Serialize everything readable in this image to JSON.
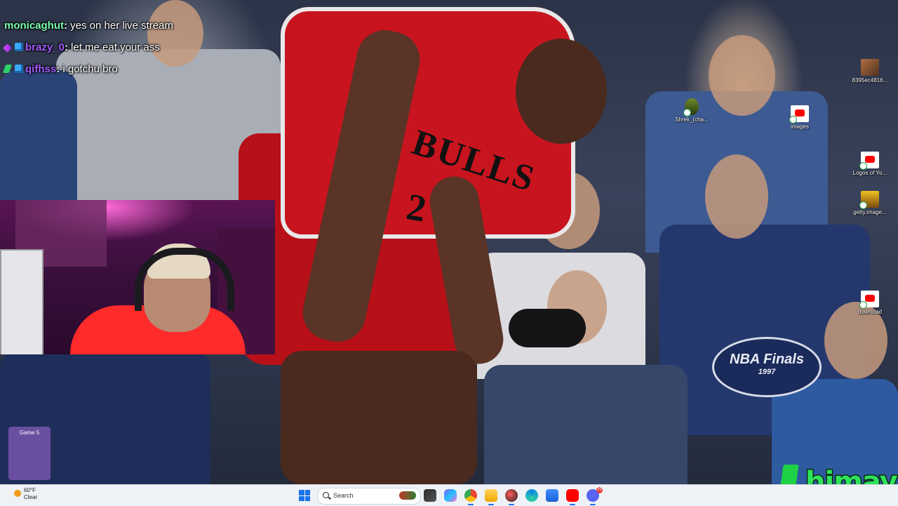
{
  "chat": {
    "messages": [
      {
        "user": "monicaghut",
        "user_color": "#7CFFB2",
        "text": "yes on her live stream",
        "badges": []
      },
      {
        "user": "brazy_0",
        "user_color": "#A45CFF",
        "text": "let me eat your ass",
        "badges": [
          "sword",
          "cube"
        ]
      },
      {
        "user": "qifhss",
        "user_color": "#A45CFF",
        "text": "i gotchu bro",
        "badges": [
          "green",
          "cube"
        ]
      }
    ],
    "separator": ":"
  },
  "photo": {
    "jersey_text": "BULLS",
    "jersey_number": "2",
    "patch_text": "NBA Finals",
    "patch_year": "1997",
    "badge_text": "Game 5"
  },
  "desktop_icons": [
    {
      "label": "8395ec4816...",
      "icon": "image-icon"
    },
    {
      "label": "Shrek_(cha...",
      "icon": "shrek-icon"
    },
    {
      "label": "images",
      "icon": "youtube-icon"
    },
    {
      "label": "Logos of Yo...",
      "icon": "youtube-icon"
    },
    {
      "label": "getty.image...",
      "icon": "image-icon"
    },
    {
      "label": "download",
      "icon": "youtube-icon"
    }
  ],
  "logo": {
    "text": "himay",
    "color": "#2FE25A"
  },
  "taskbar": {
    "weather": {
      "temp": "60°F",
      "condition": "Clear"
    },
    "search_placeholder": "Search",
    "apps": [
      {
        "name": "task-view"
      },
      {
        "name": "copilot"
      },
      {
        "name": "chrome"
      },
      {
        "name": "file-explorer"
      },
      {
        "name": "app-red"
      },
      {
        "name": "edge"
      },
      {
        "name": "store"
      },
      {
        "name": "youtube"
      },
      {
        "name": "discord",
        "badge": "29"
      }
    ]
  },
  "colors": {
    "taskbar_bg": "#EEF1F6",
    "accent": "#1A73E8",
    "jersey_red": "#C8141E"
  }
}
